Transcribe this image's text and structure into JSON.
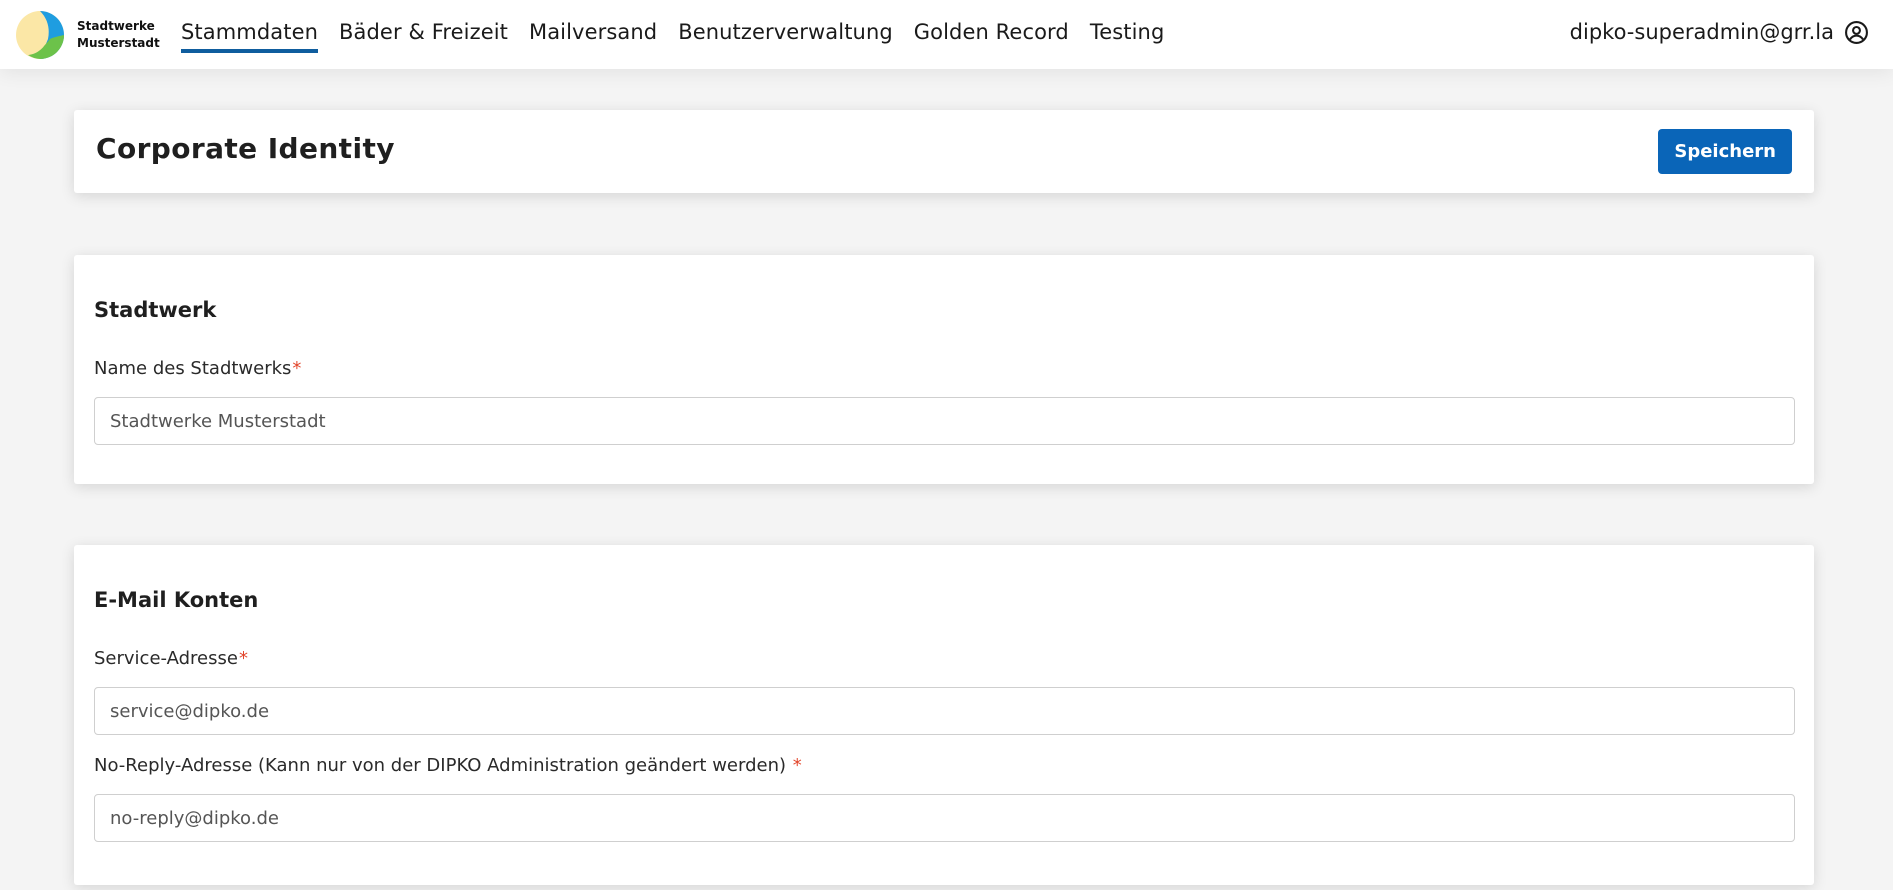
{
  "brand": {
    "line1": "Stadtwerke",
    "line2": "Musterstadt"
  },
  "nav": {
    "items": [
      {
        "label": "Stammdaten",
        "active": true
      },
      {
        "label": "Bäder & Freizeit",
        "active": false
      },
      {
        "label": "Mailversand",
        "active": false
      },
      {
        "label": "Benutzerverwaltung",
        "active": false
      },
      {
        "label": "Golden Record",
        "active": false
      },
      {
        "label": "Testing",
        "active": false
      }
    ]
  },
  "user": {
    "email": "dipko-superadmin@grr.la",
    "icon": "account-circle-icon"
  },
  "page": {
    "title": "Corporate Identity",
    "save_label": "Speichern"
  },
  "sections": {
    "stadtwerk": {
      "title": "Stadtwerk",
      "name_label": "Name des Stadtwerks",
      "name_value": "Stadtwerke Musterstadt"
    },
    "email": {
      "title": "E-Mail Konten",
      "service_label": "Service-Adresse",
      "service_value": "service@dipko.de",
      "noreply_label": "No-Reply-Adresse (Kann nur von der DIPKO Administration geändert werden) ",
      "noreply_value": "no-reply@dipko.de"
    }
  },
  "required_marker": "*",
  "colors": {
    "primary": "#0a65b8",
    "nav_underline": "#0f5d9e",
    "required": "#e2462c",
    "background": "#f4f4f4"
  }
}
